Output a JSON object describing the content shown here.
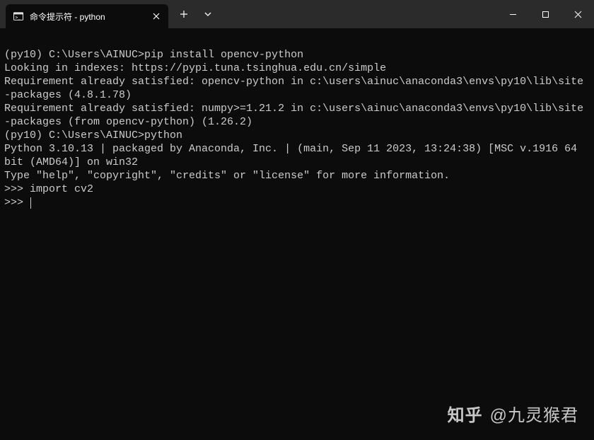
{
  "titlebar": {
    "tab_title": "命令提示符 - python"
  },
  "terminal": {
    "lines": [
      "",
      "(py10) C:\\Users\\AINUC>pip install opencv-python",
      "Looking in indexes: https://pypi.tuna.tsinghua.edu.cn/simple",
      "Requirement already satisfied: opencv-python in c:\\users\\ainuc\\anaconda3\\envs\\py10\\lib\\site-packages (4.8.1.78)",
      "Requirement already satisfied: numpy>=1.21.2 in c:\\users\\ainuc\\anaconda3\\envs\\py10\\lib\\site-packages (from opencv-python) (1.26.2)",
      "",
      "(py10) C:\\Users\\AINUC>python",
      "Python 3.10.13 | packaged by Anaconda, Inc. | (main, Sep 11 2023, 13:24:38) [MSC v.1916 64 bit (AMD64)] on win32",
      "Type \"help\", \"copyright\", \"credits\" or \"license\" for more information.",
      ">>> import cv2",
      ">>> "
    ]
  },
  "watermark": {
    "logo": "知乎",
    "author": "@九灵猴君"
  }
}
